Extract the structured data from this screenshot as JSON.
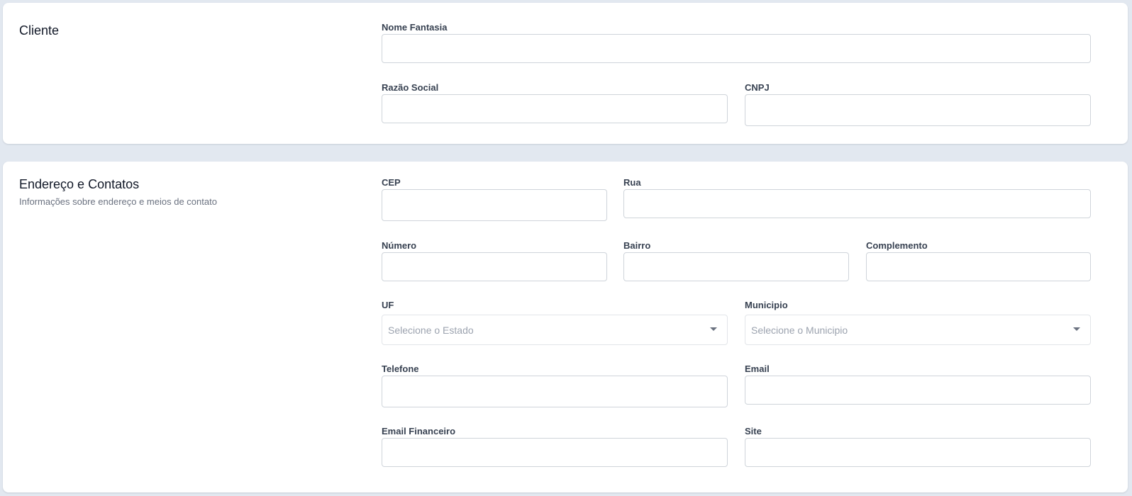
{
  "cliente": {
    "title": "Cliente",
    "fields": {
      "nome_fantasia": {
        "label": "Nome Fantasia",
        "value": ""
      },
      "razao_social": {
        "label": "Razão Social",
        "value": ""
      },
      "cnpj": {
        "label": "CNPJ",
        "value": ""
      }
    }
  },
  "endereco": {
    "title": "Endereço e Contatos",
    "subtitle": "Informações sobre endereço e meios de contato",
    "fields": {
      "cep": {
        "label": "CEP",
        "value": ""
      },
      "rua": {
        "label": "Rua",
        "value": ""
      },
      "numero": {
        "label": "Número",
        "value": ""
      },
      "bairro": {
        "label": "Bairro",
        "value": ""
      },
      "complemento": {
        "label": "Complemento",
        "value": ""
      },
      "uf": {
        "label": "UF",
        "placeholder": "Selecione o Estado"
      },
      "municipio": {
        "label": "Municipio",
        "placeholder": "Selecione o Municipio"
      },
      "telefone": {
        "label": "Telefone",
        "value": ""
      },
      "email": {
        "label": "Email",
        "value": ""
      },
      "email_financeiro": {
        "label": "Email Financeiro",
        "value": ""
      },
      "site": {
        "label": "Site",
        "value": ""
      }
    }
  },
  "colors": {
    "page_background": "#e2e8f0",
    "card_background": "#ffffff",
    "input_border": "#cfd4da",
    "label_text": "#374151",
    "placeholder_text": "#9ca3af"
  },
  "icons": {
    "select_arrow": "chevron-down-icon"
  }
}
